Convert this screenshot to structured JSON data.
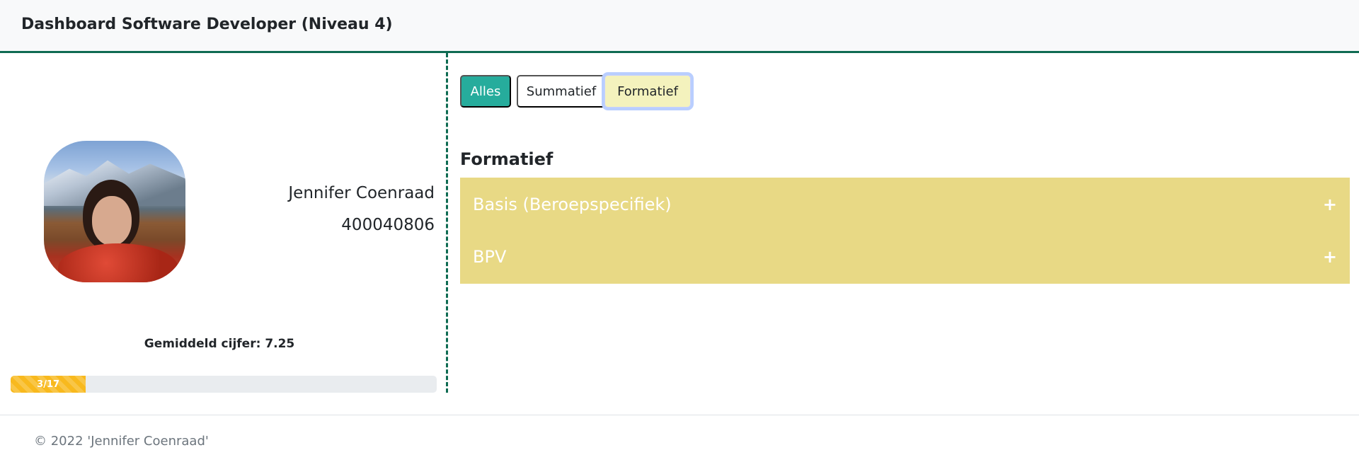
{
  "header": {
    "title": "Dashboard Software Developer (Niveau 4)"
  },
  "student": {
    "name": "Jennifer Coenraad",
    "number": "400040806",
    "average_label": "Gemiddeld cijfer:",
    "average_value": "7.25",
    "progress": {
      "label": "3/17",
      "completed": 3,
      "total": 17,
      "color": "#f8b91e"
    }
  },
  "filters": {
    "all": "Alles",
    "summative": "Summatief",
    "formative": "Formatief",
    "active": "Formatief"
  },
  "section": {
    "title": "Formatief",
    "items": [
      {
        "label": "Basis (Beroepspecifiek)",
        "expand_icon": "+"
      },
      {
        "label": "BPV",
        "expand_icon": "+"
      }
    ]
  },
  "colors": {
    "accent_teal": "#26ac9c",
    "border_green": "#0f6b52",
    "accordion_bg": "#e8d985",
    "formatief_bg": "#f4f2bd"
  },
  "footer": {
    "copyright": "© 2022 'Jennifer Coenraad'"
  }
}
